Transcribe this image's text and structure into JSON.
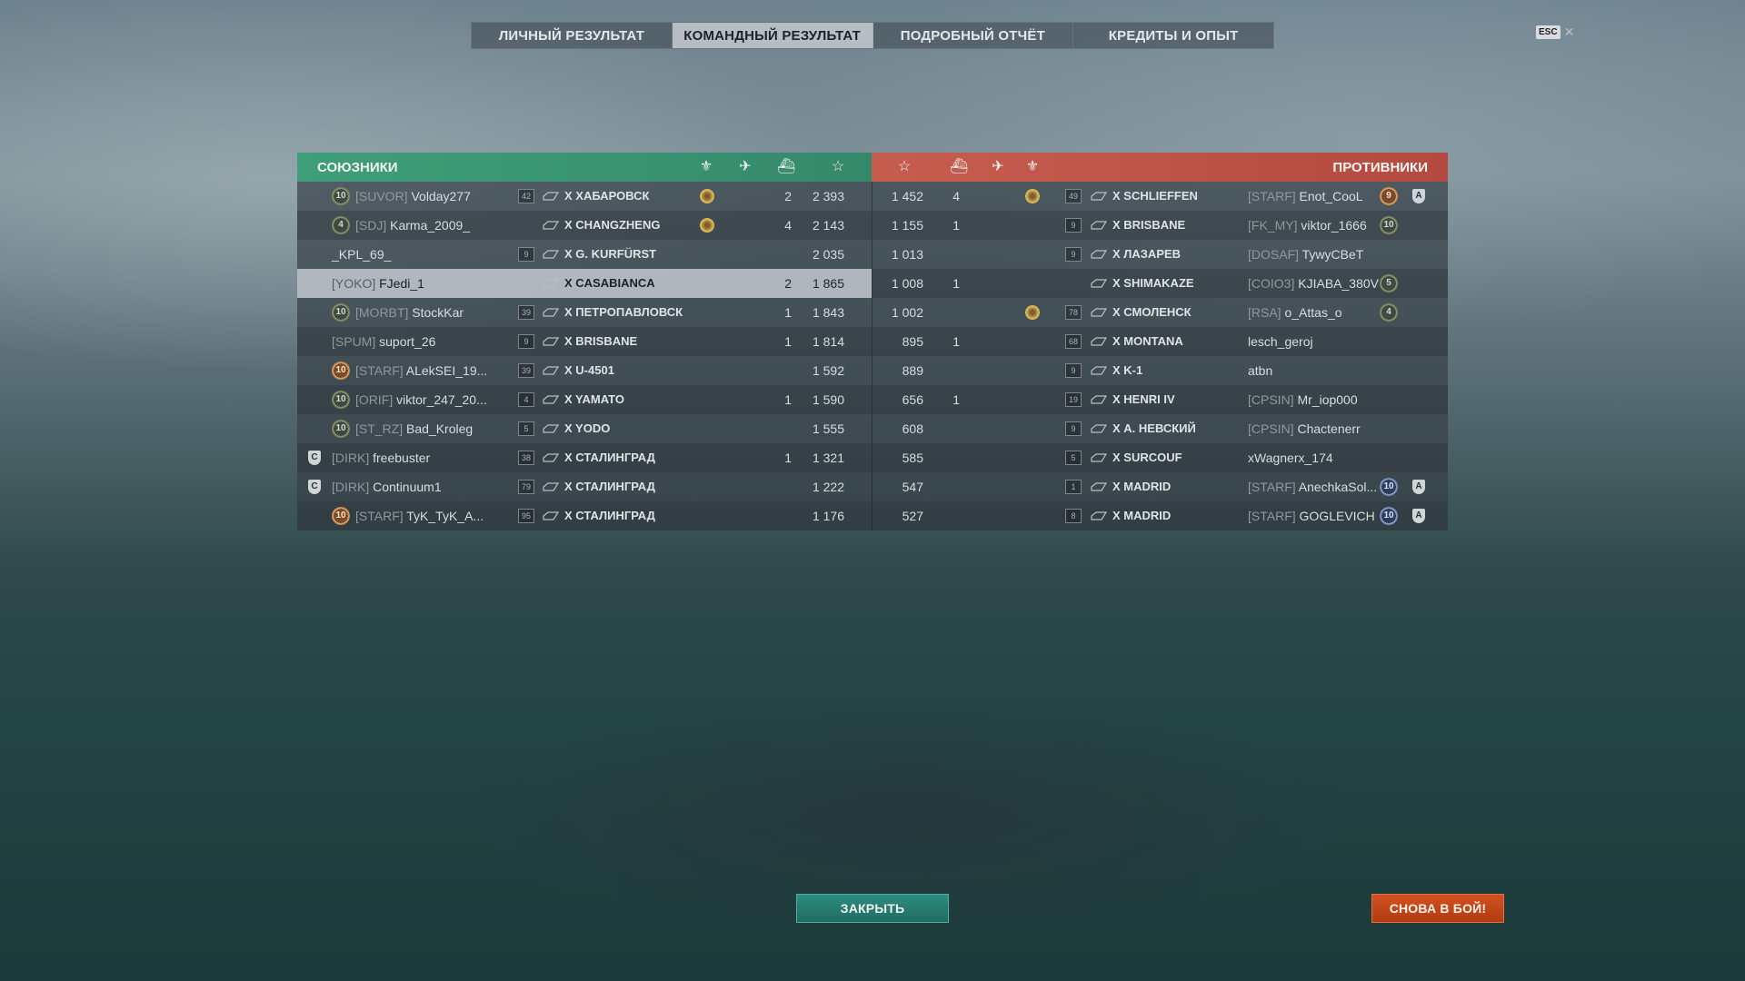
{
  "tabs": [
    {
      "label": "ЛИЧНЫЙ РЕЗУЛЬТАТ",
      "active": false
    },
    {
      "label": "КОМАНДНЫЙ РЕЗУЛЬТАТ",
      "active": true
    },
    {
      "label": "ПОДРОБНЫЙ ОТЧЁТ",
      "active": false
    },
    {
      "label": "КРЕДИТЫ И ОПЫТ",
      "active": false
    }
  ],
  "esc_label": "ESC",
  "allies_title": "СОЮЗНИКИ",
  "enemies_title": "ПРОТИВНИКИ",
  "allies": [
    {
      "rank": "10",
      "clan": "[SUVOR]",
      "name": "Volday277",
      "lvl": "42",
      "ship": "X ХАБАРОВСК",
      "ach": true,
      "kills": "2",
      "xp": "2 393"
    },
    {
      "rank": "4",
      "clan": "[SDJ]",
      "name": "Karma_2009_",
      "lvl": "",
      "ship": "X CHANGZHENG",
      "ach": true,
      "kills": "4",
      "xp": "2 143"
    },
    {
      "rank": "",
      "clan": "",
      "name": "_KPL_69_",
      "lvl": "9",
      "ship": "X G. KURFÜRST",
      "ach": false,
      "kills": "",
      "xp": "2 035"
    },
    {
      "rank": "",
      "clan": "[YOKO]",
      "name": "FJedi_1",
      "lvl": "",
      "ship": "X CASABIANCA",
      "ach": false,
      "kills": "2",
      "xp": "1 865"
    },
    {
      "rank": "10",
      "clan": "[MORBT]",
      "name": "StockKar",
      "lvl": "39",
      "ship": "X ПЕТРОПАВЛОВСК",
      "ach": false,
      "kills": "1",
      "xp": "1 843"
    },
    {
      "rank": "",
      "clan": "[SPUM]",
      "name": "suport_26",
      "lvl": "9",
      "ship": "X BRISBANE",
      "ach": false,
      "kills": "1",
      "xp": "1 814"
    },
    {
      "rank": "10",
      "clan": "[STARF]",
      "name": "ALekSEI_19...",
      "lvl": "39",
      "ship": "X U-4501",
      "ach": false,
      "kills": "",
      "xp": "1 592"
    },
    {
      "rank": "10",
      "clan": "[ORIF]",
      "name": "viktor_247_20...",
      "lvl": "4",
      "ship": "X YAMATO",
      "ach": false,
      "kills": "1",
      "xp": "1 590"
    },
    {
      "rank": "10",
      "clan": "[ST_RZ]",
      "name": "Bad_Kroleg",
      "lvl": "5",
      "ship": "X YODO",
      "ach": false,
      "kills": "",
      "xp": "1 555"
    },
    {
      "rank": "",
      "clan": "[DIRK]",
      "name": "freebuster",
      "lvl": "38",
      "ship": "X СТАЛИНГРАД",
      "ach": false,
      "kills": "1",
      "xp": "1 321",
      "shield": "C"
    },
    {
      "rank": "",
      "clan": "[DIRK]",
      "name": "Continuum1",
      "lvl": "79",
      "ship": "X СТАЛИНГРАД",
      "ach": false,
      "kills": "",
      "xp": "1 222",
      "shield": "C"
    },
    {
      "rank": "10",
      "clan": "[STARF]",
      "name": "TyK_TyK_A...",
      "lvl": "95",
      "ship": "X СТАЛИНГРАД",
      "ach": false,
      "kills": "",
      "xp": "1 176"
    }
  ],
  "enemies": [
    {
      "xp": "1 452",
      "kills": "4",
      "ach": true,
      "lvl": "49",
      "ship": "X SCHLIEFFEN",
      "clan": "[STARF]",
      "name": "Enot_CooL",
      "rank": "9",
      "rank_style": "gold",
      "tag": "A"
    },
    {
      "xp": "1 155",
      "kills": "1",
      "ach": false,
      "lvl": "9",
      "ship": "X BRISBANE",
      "clan": "[FK_MY]",
      "name": "viktor_1666",
      "rank": "10",
      "rank_style": "",
      "tag": ""
    },
    {
      "xp": "1 013",
      "kills": "",
      "ach": false,
      "lvl": "9",
      "ship": "X ЛАЗАРЕВ",
      "clan": "[DOSAF]",
      "name": "TywyCBeT",
      "rank": "",
      "rank_style": "",
      "tag": ""
    },
    {
      "xp": "1 008",
      "kills": "1",
      "ach": false,
      "lvl": "",
      "ship": "X SHIMAKAZE",
      "clan": "[COIO3]",
      "name": "KJIABA_380V",
      "rank": "5",
      "rank_style": "",
      "tag": ""
    },
    {
      "xp": "1 002",
      "kills": "",
      "ach": true,
      "lvl": "78",
      "ship": "X СМОЛЕНСК",
      "clan": "[RSA]",
      "name": "o_Attas_o",
      "rank": "4",
      "rank_style": "",
      "tag": ""
    },
    {
      "xp": "895",
      "kills": "1",
      "ach": false,
      "lvl": "68",
      "ship": "X MONTANA",
      "clan": "",
      "name": "lesch_geroj",
      "rank": "",
      "rank_style": "",
      "tag": ""
    },
    {
      "xp": "889",
      "kills": "",
      "ach": false,
      "lvl": "9",
      "ship": "X K-1",
      "clan": "",
      "name": "atbn",
      "rank": "",
      "rank_style": "",
      "tag": ""
    },
    {
      "xp": "656",
      "kills": "1",
      "ach": false,
      "lvl": "19",
      "ship": "X HENRI IV",
      "clan": "[CPSIN]",
      "name": "Mr_iop000",
      "rank": "",
      "rank_style": "",
      "tag": ""
    },
    {
      "xp": "608",
      "kills": "",
      "ach": false,
      "lvl": "9",
      "ship": "X А. НЕВСКИЙ",
      "clan": "[CPSIN]",
      "name": "Chactenerr",
      "rank": "",
      "rank_style": "",
      "tag": ""
    },
    {
      "xp": "585",
      "kills": "",
      "ach": false,
      "lvl": "5",
      "ship": "X SURCOUF",
      "clan": "",
      "name": "xWagnerx_174",
      "rank": "",
      "rank_style": "",
      "tag": ""
    },
    {
      "xp": "547",
      "kills": "",
      "ach": false,
      "lvl": "1",
      "ship": "X MADRID",
      "clan": "[STARF]",
      "name": "AnechkaSol...",
      "rank": "10",
      "rank_style": "blue",
      "tag": "A"
    },
    {
      "xp": "527",
      "kills": "",
      "ach": false,
      "lvl": "8",
      "ship": "X MADRID",
      "clan": "[STARF]",
      "name": "GOGLEVICH",
      "rank": "10",
      "rank_style": "blue",
      "tag": "A"
    }
  ],
  "buttons": {
    "close": "ЗАКРЫТЬ",
    "battle": "СНОВА В БОЙ!"
  }
}
